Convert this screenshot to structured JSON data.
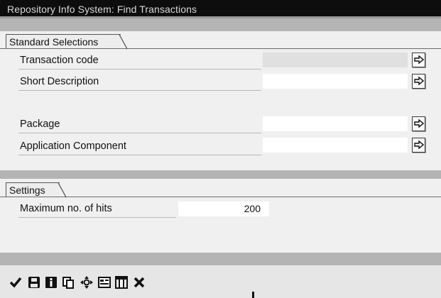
{
  "window": {
    "title": "Repository Info System: Find Transactions"
  },
  "standard_selections": {
    "tab_label": "Standard Selections",
    "fields": [
      {
        "label": "Transaction code",
        "value": "",
        "disabled": true
      },
      {
        "label": "Short Description",
        "value": ""
      },
      {
        "label": "Package",
        "value": ""
      },
      {
        "label": "Application Component",
        "value": ""
      }
    ],
    "more_icon": "arrow-right-icon"
  },
  "settings": {
    "tab_label": "Settings",
    "max_hits_label": "Maximum no. of hits",
    "max_hits_value": "200"
  },
  "toolbar": {
    "buttons": [
      {
        "icon": "checkmark-icon"
      },
      {
        "icon": "save-icon"
      },
      {
        "icon": "info-icon"
      },
      {
        "icon": "copy-icon"
      },
      {
        "icon": "navigate-icon"
      },
      {
        "icon": "display-list-icon"
      },
      {
        "icon": "table-settings-icon"
      },
      {
        "icon": "cancel-icon"
      }
    ]
  }
}
